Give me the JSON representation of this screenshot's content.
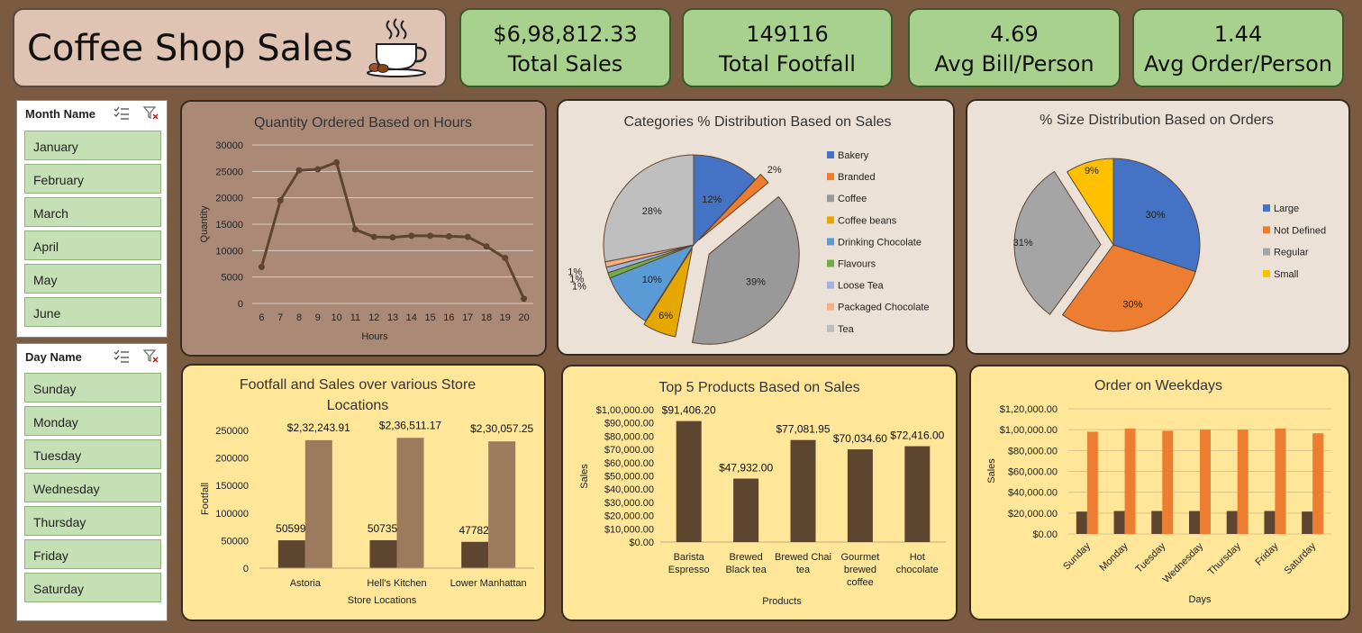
{
  "header": {
    "title": "Coffee Shop Sales",
    "logo_icon": "coffee-cup-icon"
  },
  "kpis": [
    {
      "value": "$6,98,812.33",
      "label": "Total Sales"
    },
    {
      "value": "149116",
      "label": "Total Footfall"
    },
    {
      "value": "4.69",
      "label": "Avg Bill/Person"
    },
    {
      "value": "1.44",
      "label": "Avg Order/Person"
    }
  ],
  "slicers": {
    "month": {
      "header": "Month Name",
      "items": [
        "January",
        "February",
        "March",
        "April",
        "May",
        "June"
      ]
    },
    "day": {
      "header": "Day Name",
      "items": [
        "Sunday",
        "Monday",
        "Tuesday",
        "Wednesday",
        "Thursday",
        "Friday",
        "Saturday"
      ]
    }
  },
  "colors": {
    "brown_dark": "#5e4530",
    "brown_light": "#9c7a5e",
    "orange": "#ed7d31",
    "panel_brown": "#aa8a76",
    "panel_beige": "#ece1d6",
    "panel_yellow": "#ffe699",
    "kpi_green": "#a9d18e"
  },
  "chart_data": [
    {
      "type": "line",
      "title": "Quantity Ordered Based on Hours",
      "xlabel": "Hours",
      "ylabel": "Quantity",
      "x": [
        6,
        7,
        8,
        9,
        10,
        11,
        12,
        13,
        14,
        15,
        16,
        17,
        18,
        19,
        20
      ],
      "values": [
        6900,
        19500,
        25200,
        25400,
        26700,
        14000,
        12600,
        12500,
        12800,
        12800,
        12700,
        12600,
        10800,
        8600,
        900
      ],
      "y_ticks": [
        0,
        5000,
        10000,
        15000,
        20000,
        25000,
        30000
      ],
      "ylim": [
        0,
        30000
      ],
      "grid": true
    },
    {
      "type": "pie",
      "title": "Categories % Distribution Based on Sales",
      "legend_position": "right",
      "slices": [
        {
          "name": "Bakery",
          "value": 12,
          "label": "12%",
          "color": "#4472c4"
        },
        {
          "name": "Branded",
          "value": 2,
          "label": "2%",
          "color": "#ed7d31"
        },
        {
          "name": "Coffee",
          "value": 39,
          "label": "39%",
          "color": "#999999"
        },
        {
          "name": "Coffee beans",
          "value": 6,
          "label": "6%",
          "color": "#e6a800"
        },
        {
          "name": "Drinking Chocolate",
          "value": 10,
          "label": "10%",
          "color": "#5b9bd5"
        },
        {
          "name": "Flavours",
          "value": 1,
          "label": "1%",
          "color": "#70ad47"
        },
        {
          "name": "Loose Tea",
          "value": 1,
          "label": "1%",
          "color": "#9fb4e0"
        },
        {
          "name": "Packaged Chocolate",
          "value": 1,
          "label": "1%",
          "color": "#f4b183"
        },
        {
          "name": "Tea",
          "value": 28,
          "label": "28%",
          "color": "#bfbfbf"
        }
      ]
    },
    {
      "type": "pie",
      "title": "% Size Distribution Based on Orders",
      "legend_position": "right",
      "slices": [
        {
          "name": "Large",
          "value": 30,
          "label": "30%",
          "color": "#4472c4"
        },
        {
          "name": "Not Defined",
          "value": 30,
          "label": "30%",
          "color": "#ed7d31"
        },
        {
          "name": "Regular",
          "value": 31,
          "label": "31%",
          "color": "#a5a5a5"
        },
        {
          "name": "Small",
          "value": 9,
          "label": "9%",
          "color": "#ffc000"
        }
      ]
    },
    {
      "type": "bar",
      "title": "Footfall and Sales over various Store Locations",
      "xlabel": "Store Locations",
      "ylabel": "Footfall",
      "categories": [
        "Astoria",
        "Hell's Kitchen",
        "Lower Manhattan"
      ],
      "series": [
        {
          "values": [
            50599,
            50735,
            47782
          ],
          "labels": [
            "50599",
            "50735",
            "47782"
          ]
        },
        {
          "values": [
            232243.91,
            236511.17,
            230057.25
          ],
          "labels": [
            "$2,32,243.91",
            "$2,36,511.17",
            "$2,30,057.25"
          ]
        }
      ],
      "y_ticks": [
        0,
        50000,
        100000,
        150000,
        200000,
        250000
      ],
      "ylim": [
        0,
        250000
      ]
    },
    {
      "type": "bar",
      "title": "Top 5 Products Based on Sales",
      "xlabel": "Products",
      "ylabel": "Sales",
      "categories": [
        "Barista Espresso",
        "Brewed Black tea",
        "Brewed Chai tea",
        "Gourmet brewed coffee",
        "Hot chocolate"
      ],
      "category_lines": [
        [
          "Barista",
          "Espresso"
        ],
        [
          "Brewed",
          "Black tea"
        ],
        [
          "Brewed Chai",
          "tea"
        ],
        [
          "Gourmet",
          "brewed",
          "coffee"
        ],
        [
          "Hot",
          "chocolate"
        ]
      ],
      "values": [
        91406.2,
        47932.0,
        77081.95,
        70034.6,
        72416.0
      ],
      "labels": [
        "$91,406.20",
        "$47,932.00",
        "$77,081.95",
        "$70,034.60",
        "$72,416.00"
      ],
      "y_ticks": [
        "$0.00",
        "$10,000.00",
        "$20,000.00",
        "$30,000.00",
        "$40,000.00",
        "$50,000.00",
        "$60,000.00",
        "$70,000.00",
        "$80,000.00",
        "$90,000.00",
        "$1,00,000.00"
      ],
      "ylim": [
        0,
        100000
      ]
    },
    {
      "type": "bar",
      "title": "Order on Weekdays",
      "xlabel": "Days",
      "ylabel": "Sales",
      "categories": [
        "Sunday",
        "Monday",
        "Tuesday",
        "Wednesday",
        "Thursday",
        "Friday",
        "Saturday"
      ],
      "series": [
        {
          "values": [
            21500,
            22000,
            22000,
            22000,
            22000,
            22000,
            21500
          ]
        },
        {
          "values": [
            98000,
            101000,
            99000,
            100000,
            100000,
            101000,
            96500
          ]
        }
      ],
      "y_ticks": [
        "$0.00",
        "$20,000.00",
        "$40,000.00",
        "$60,000.00",
        "$80,000.00",
        "$1,00,000.00",
        "$1,20,000.00"
      ],
      "ylim": [
        0,
        120000
      ],
      "grid": true
    }
  ]
}
